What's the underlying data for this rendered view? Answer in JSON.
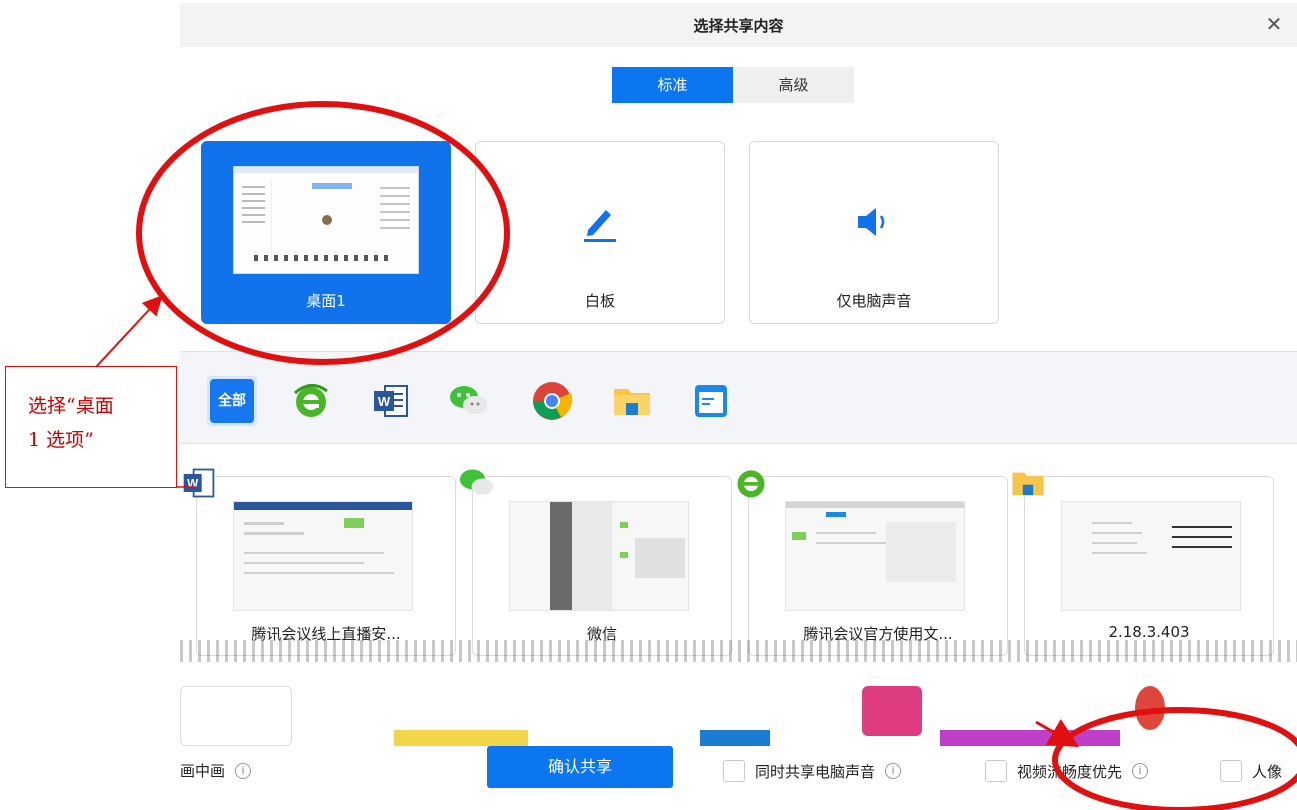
{
  "dialog": {
    "title": "选择共享内容",
    "close_glyph": "✕"
  },
  "tabs": [
    {
      "label": "标准",
      "active": true
    },
    {
      "label": "高级",
      "active": false
    }
  ],
  "sources": [
    {
      "label": "桌面1",
      "selected": true
    },
    {
      "label": "白板",
      "selected": false
    },
    {
      "label": "仅电脑声音",
      "selected": false
    }
  ],
  "app_filter": {
    "all_label": "全部",
    "apps": [
      "ie-browser-icon",
      "word-icon",
      "wechat-icon",
      "chrome-icon",
      "file-explorer-icon",
      "window-app-icon"
    ]
  },
  "windows": [
    {
      "label": "腾讯会议线上直播安...",
      "app": "word-icon"
    },
    {
      "label": "微信",
      "app": "wechat-icon"
    },
    {
      "label": "腾讯会议官方使用文...",
      "app": "ie-browser-icon"
    },
    {
      "label": "2.18.3.403",
      "app": "file-explorer-icon"
    }
  ],
  "bottom": {
    "pip_label": "画中画",
    "confirm_label": "确认共享",
    "share_audio_label": "同时共享电脑声音",
    "smooth_video_label": "视频流畅度优先",
    "portrait_label": "人像",
    "info_glyph": "i"
  },
  "annotation": {
    "callout_line1": "选择“桌面",
    "callout_line2": "1 选项”",
    "accent_color": "#e01010"
  },
  "colors": {
    "primary": "#0c75f0"
  }
}
